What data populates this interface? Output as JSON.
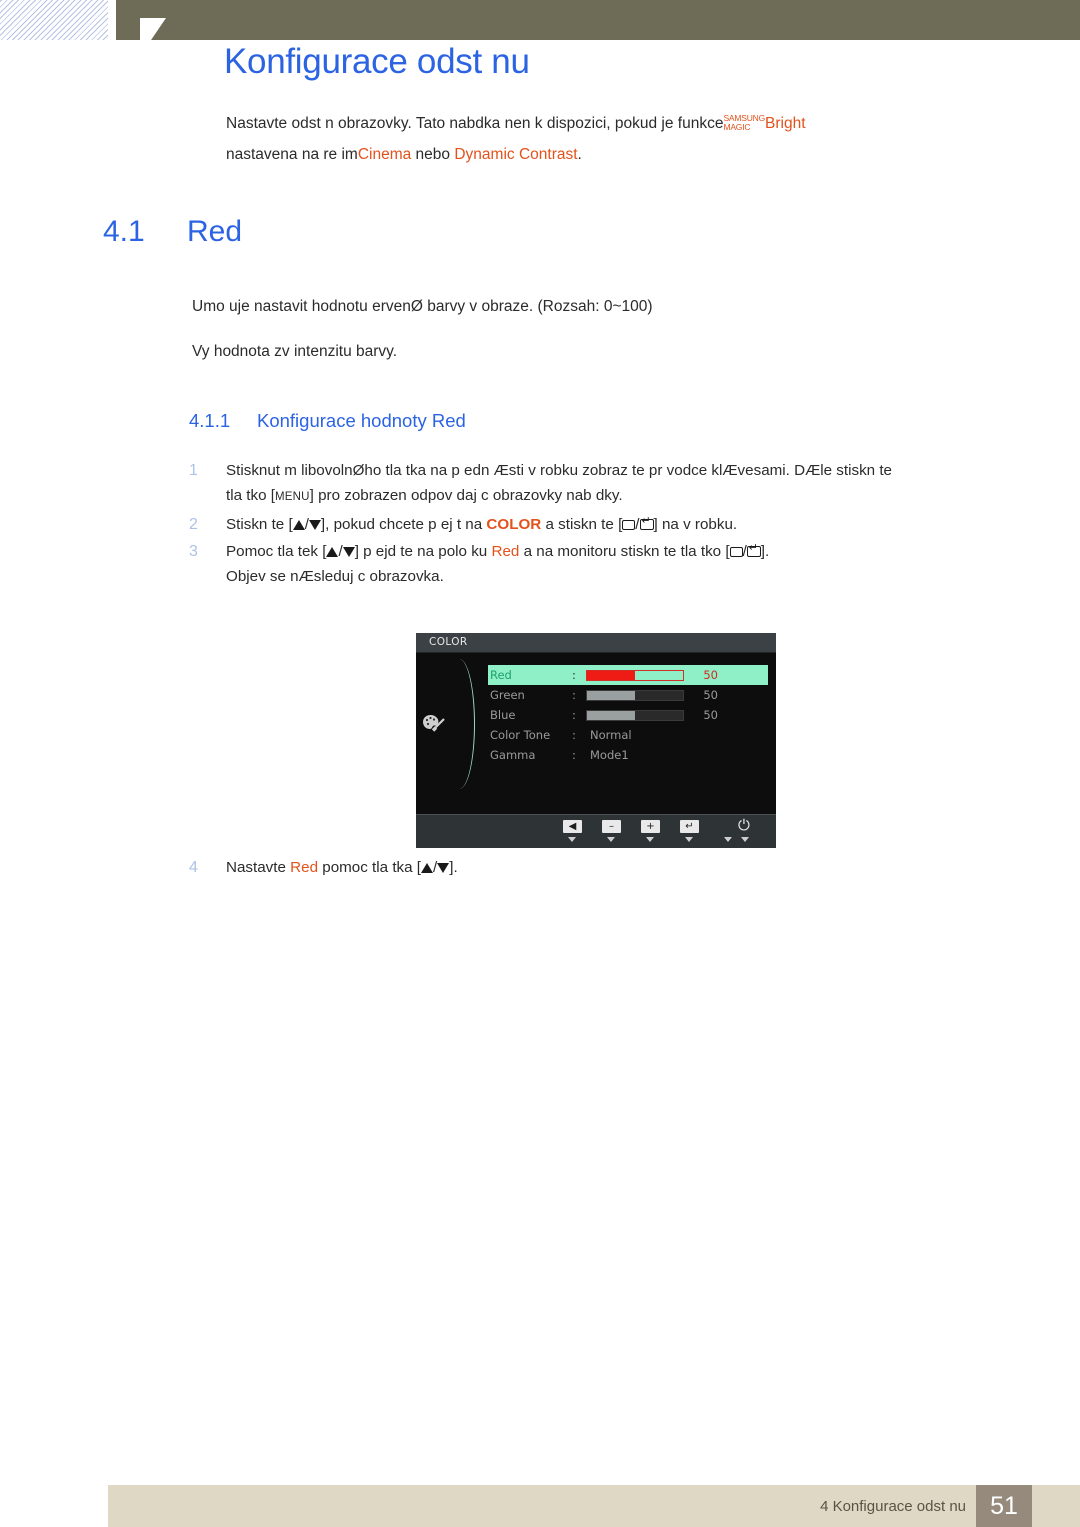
{
  "chapter": {
    "title": "Konfigurace odst nu",
    "intro_part1": "Nastavte odst n obrazovky. Tato nab",
    "intro_part1b": "dka nen  k dispozici, pokud je funkce",
    "magic_top": "SAMSUNG",
    "magic_bottom": "MAGIC",
    "bright": "Bright",
    "intro_part2": "nastavena na re im",
    "cinema": "Cinema",
    "nebo": " nebo ",
    "dynamic_contrast": "Dynamic Contrast",
    "period": "."
  },
  "section": {
    "number": "4.1",
    "title": "Red",
    "body1": "Umo  uje nastavit hodnotu  ervenØ barvy v obraze. (Rozsah: 0~100)",
    "body2": "Vy    hodnota zv    intenzitu barvy."
  },
  "subsection": {
    "number": "4.1.1",
    "title": "Konfigurace hodnoty Red"
  },
  "steps": [
    {
      "n": "1",
      "line1_a": "Stisknut m libovolnØho tla  tka na p edn   Æsti v robku zobraz te pr vodce klÆvesami. DÆle stiskn te",
      "line2_a": "tla  tko [",
      "menu_key": "MENU",
      "line2_b": "] pro zobrazen  odpov daj c  obrazovky nab dky."
    },
    {
      "n": "2",
      "a": "Stiskn te [",
      "b": "], pokud chcete p ej t na ",
      "color_label": "COLOR",
      "c": " a stiskn te [",
      "d": "] na v robku."
    },
    {
      "n": "3",
      "a": "Pomoc  tla  tek [",
      "b": "] p ejd te na polo ku ",
      "red_label": "Red",
      "c": " a na monitoru stiskn te tla  tko [",
      "d": "].",
      "line2": "Objev  se nÆsleduj c  obrazovka."
    },
    {
      "n": "4",
      "a": "Nastavte ",
      "red_label": "Red",
      "b": " pomoc  tla  tka [",
      "c": "]."
    }
  ],
  "osd": {
    "title": "COLOR",
    "rows": [
      {
        "label": "Red",
        "colon": ":",
        "type": "slider",
        "value": "50",
        "fill_pct": 50,
        "highlighted": true
      },
      {
        "label": "Green",
        "colon": ":",
        "type": "slider",
        "value": "50",
        "fill_pct": 50,
        "highlighted": false
      },
      {
        "label": "Blue",
        "colon": ":",
        "type": "slider",
        "value": "50",
        "fill_pct": 50,
        "highlighted": false
      },
      {
        "label": "Color Tone",
        "colon": ":",
        "type": "text",
        "value": "Normal",
        "highlighted": false
      },
      {
        "label": "Gamma",
        "colon": ":",
        "type": "text",
        "value": "Mode1",
        "highlighted": false
      }
    ],
    "buttons": [
      {
        "name": "back-button",
        "glyph": "◀"
      },
      {
        "name": "minus-button",
        "glyph": "–"
      },
      {
        "name": "plus-button",
        "glyph": "+"
      },
      {
        "name": "enter-button",
        "glyph": "↵"
      }
    ],
    "power_glyph": "⏻"
  },
  "footer": {
    "text": "4 Konfigurace odst nu",
    "page": "51"
  },
  "colors": {
    "heading_blue": "#2b63e3",
    "accent_orange": "#e2521b",
    "olive": "#6e6c56",
    "footer_band": "#ded8c4",
    "footer_box": "#968a7d",
    "osd_highlight": "#8ff0c8",
    "osd_red": "#ee1c14"
  }
}
